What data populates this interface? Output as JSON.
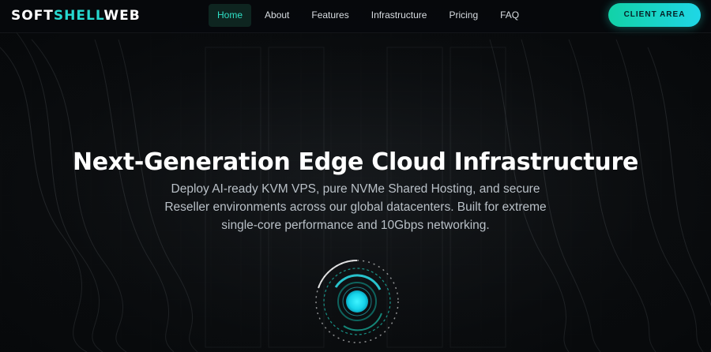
{
  "brand": {
    "logo_part1": "SOFT",
    "logo_part2": "SHELL",
    "logo_part3": "WEB",
    "accent_color": "#27d8cf"
  },
  "nav": {
    "items": [
      {
        "label": "Home",
        "active": true
      },
      {
        "label": "About",
        "active": false
      },
      {
        "label": "Features",
        "active": false
      },
      {
        "label": "Infrastructure",
        "active": false
      },
      {
        "label": "Pricing",
        "active": false
      },
      {
        "label": "FAQ",
        "active": false
      }
    ],
    "client_area_label": "CLIENT AREA"
  },
  "hero": {
    "title": "Next-Generation Edge Cloud Infrastructure",
    "subtitle": "Deploy AI-ready KVM VPS, pure NVMe Shared Hosting, and secure Reseller environments across our global datacenters. Built for extreme single-core performance and 10Gbps networking."
  },
  "icons": {
    "radar": "radar-pulse-icon"
  }
}
